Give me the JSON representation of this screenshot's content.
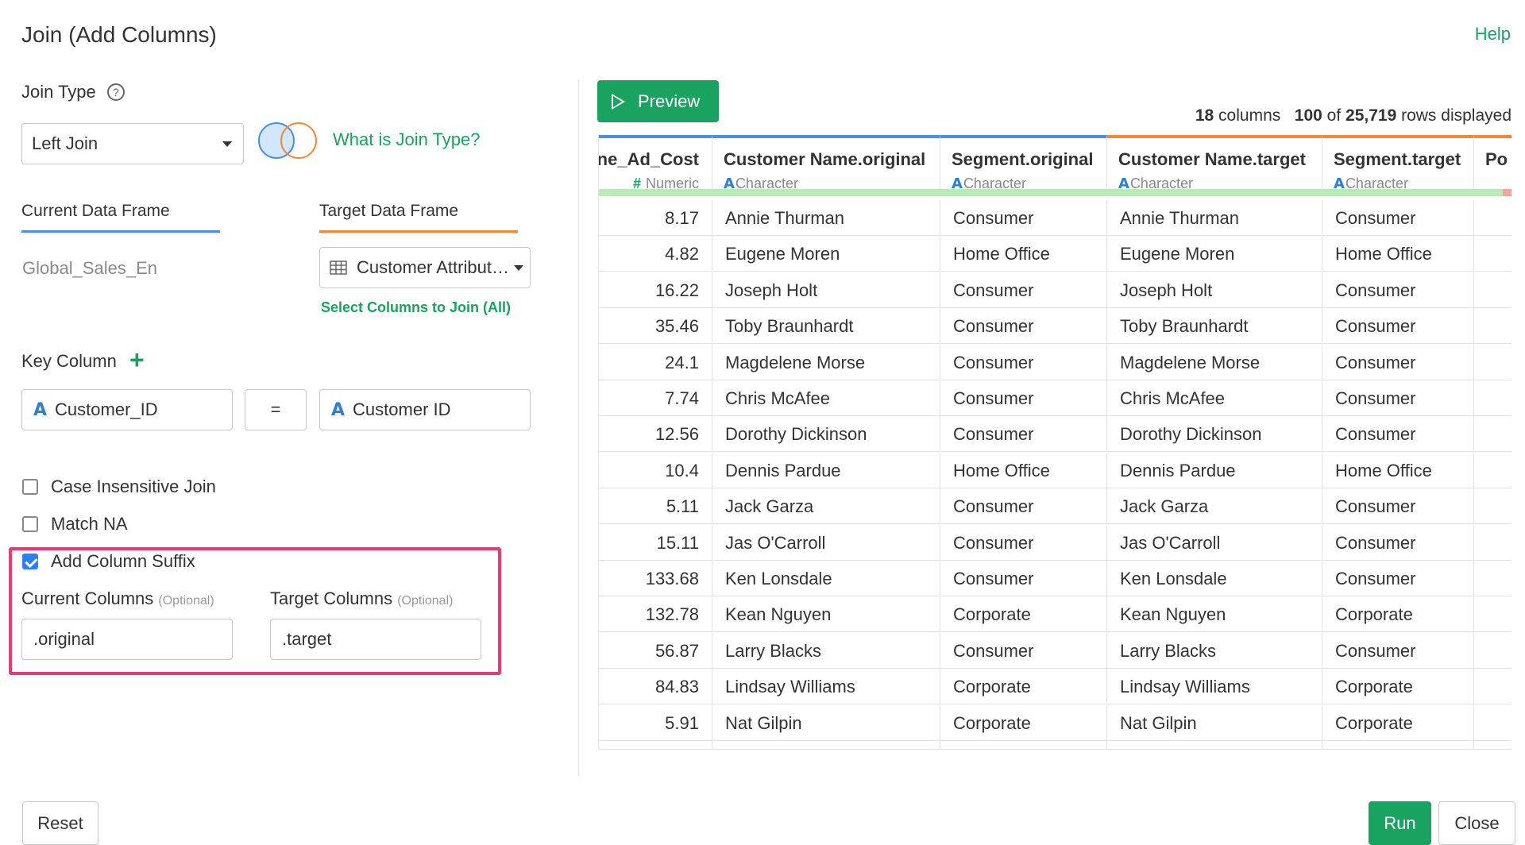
{
  "dialog": {
    "title": "Join (Add Columns)",
    "help": "Help"
  },
  "join_type": {
    "label": "Join Type",
    "help_icon": "?",
    "selected": "Left Join",
    "what_is_link": "What is Join Type?"
  },
  "frames": {
    "current_tab": "Current Data Frame",
    "target_tab": "Target Data Frame",
    "current_value": "Global_Sales_En",
    "target_value": "Customer Attribut…",
    "select_columns_link": "Select Columns to Join (All)"
  },
  "key_column": {
    "label": "Key Column",
    "add_icon": "+",
    "left": "Customer_ID",
    "operator": "=",
    "right": "Customer ID",
    "type_glyph": "A"
  },
  "options": {
    "case_insensitive": {
      "label": "Case Insensitive Join",
      "checked": false
    },
    "match_na": {
      "label": "Match NA",
      "checked": false
    },
    "add_suffix": {
      "label": "Add Column Suffix",
      "checked": true
    }
  },
  "suffix": {
    "current_label": "Current Columns",
    "target_label": "Target Columns",
    "optional": "(Optional)",
    "current_value": ".original",
    "target_value": ".target"
  },
  "preview": {
    "button": "Preview",
    "columns_count": "18",
    "columns_word": "columns",
    "rows_shown": "100",
    "rows_of": "of",
    "rows_total": "25,719",
    "rows_word": "rows displayed"
  },
  "table": {
    "columns": [
      {
        "name": "ne_Ad_Cost",
        "type_glyph": "#",
        "type": "Numeric",
        "color": "#4a90e2"
      },
      {
        "name": "Customer Name.original",
        "type_glyph": "A",
        "type": "Character",
        "color": "#4a90e2"
      },
      {
        "name": "Segment.original",
        "type_glyph": "A",
        "type": "Character",
        "color": "#4a90e2"
      },
      {
        "name": "Customer Name.target",
        "type_glyph": "A",
        "type": "Character",
        "color": "#f0883a"
      },
      {
        "name": "Segment.target",
        "type_glyph": "A",
        "type": "Character",
        "color": "#f0883a"
      },
      {
        "name": "Po",
        "type_glyph": "",
        "type": "",
        "color": "#f0883a"
      }
    ],
    "rows": [
      [
        "8.17",
        "Annie Thurman",
        "Consumer",
        "Annie Thurman",
        "Consumer"
      ],
      [
        "4.82",
        "Eugene Moren",
        "Home Office",
        "Eugene Moren",
        "Home Office"
      ],
      [
        "16.22",
        "Joseph Holt",
        "Consumer",
        "Joseph Holt",
        "Consumer"
      ],
      [
        "35.46",
        "Toby Braunhardt",
        "Consumer",
        "Toby Braunhardt",
        "Consumer"
      ],
      [
        "24.1",
        "Magdelene Morse",
        "Consumer",
        "Magdelene Morse",
        "Consumer"
      ],
      [
        "7.74",
        "Chris McAfee",
        "Consumer",
        "Chris McAfee",
        "Consumer"
      ],
      [
        "12.56",
        "Dorothy Dickinson",
        "Consumer",
        "Dorothy Dickinson",
        "Consumer"
      ],
      [
        "10.4",
        "Dennis Pardue",
        "Home Office",
        "Dennis Pardue",
        "Home Office"
      ],
      [
        "5.11",
        "Jack Garza",
        "Consumer",
        "Jack Garza",
        "Consumer"
      ],
      [
        "15.11",
        "Jas O'Carroll",
        "Consumer",
        "Jas O'Carroll",
        "Consumer"
      ],
      [
        "133.68",
        "Ken Lonsdale",
        "Consumer",
        "Ken Lonsdale",
        "Consumer"
      ],
      [
        "132.78",
        "Kean Nguyen",
        "Corporate",
        "Kean Nguyen",
        "Corporate"
      ],
      [
        "56.87",
        "Larry Blacks",
        "Consumer",
        "Larry Blacks",
        "Consumer"
      ],
      [
        "84.83",
        "Lindsay Williams",
        "Corporate",
        "Lindsay Williams",
        "Corporate"
      ],
      [
        "5.91",
        "Nat Gilpin",
        "Corporate",
        "Nat Gilpin",
        "Corporate"
      ]
    ]
  },
  "footer": {
    "reset": "Reset",
    "run": "Run",
    "close": "Close"
  },
  "colors": {
    "accent": "#1aa260",
    "current": "#4a90e2",
    "target": "#f0883a",
    "highlight": "#e8397a"
  }
}
